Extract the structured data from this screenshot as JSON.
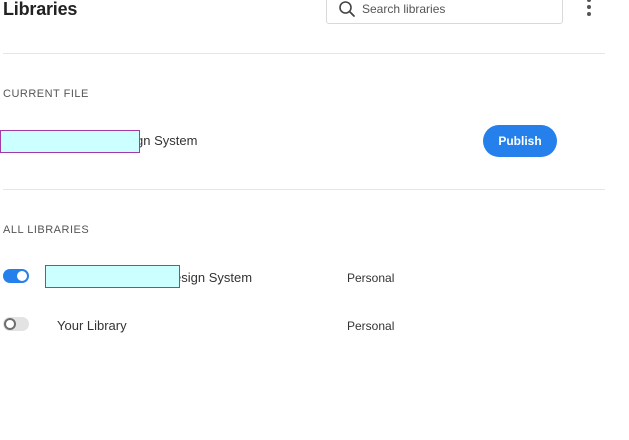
{
  "header": {
    "title": "Libraries",
    "search_placeholder": "Search libraries",
    "search_value": ""
  },
  "current_file": {
    "section_label": "CURRENT FILE",
    "library_name_visible": "gn System",
    "publish_label": "Publish"
  },
  "all_libraries": {
    "section_label": "ALL LIBRARIES",
    "items": [
      {
        "name_visible": "esign System",
        "owner": "Personal",
        "enabled": true
      },
      {
        "name_visible": "Your Library",
        "owner": "Personal",
        "enabled": false
      }
    ]
  },
  "colors": {
    "accent": "#2680eb",
    "redaction_fill": "#ccffff",
    "redaction_border": "#a23aa8"
  },
  "icons": {
    "search": "search-icon",
    "more": "more-vertical-icon"
  }
}
